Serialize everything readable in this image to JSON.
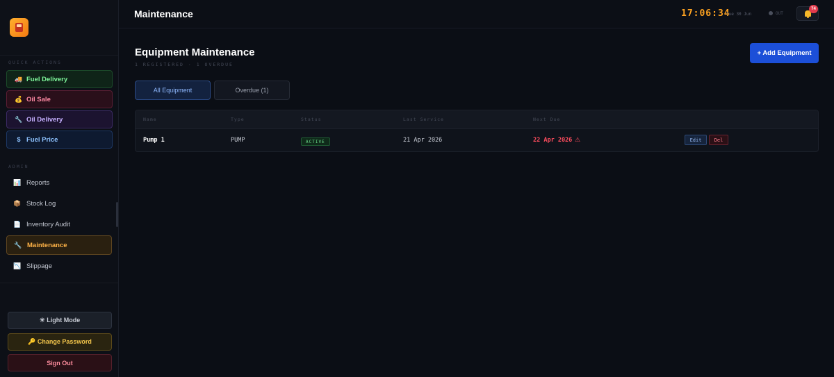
{
  "header": {
    "title": "Maintenance",
    "clock": "17:06:34",
    "date": "Tue 30 Jun",
    "shift_status": "OUT",
    "notification_count": "74"
  },
  "sidebar": {
    "quick_actions_label": "QUICK ACTIONS",
    "quick_actions": [
      {
        "label": "Fuel Delivery",
        "icon": "🚚"
      },
      {
        "label": "Oil Sale",
        "icon": "💰"
      },
      {
        "label": "Oil Delivery",
        "icon": "🔧"
      },
      {
        "label": "Fuel Price",
        "icon": "$"
      }
    ],
    "admin_label": "ADMIN",
    "admin_items": [
      {
        "label": "Reports",
        "icon": "📊"
      },
      {
        "label": "Stock Log",
        "icon": "📦"
      },
      {
        "label": "Inventory Audit",
        "icon": "📄"
      },
      {
        "label": "Maintenance",
        "icon": "🔧"
      },
      {
        "label": "Slippage",
        "icon": "📉"
      }
    ],
    "bottom": {
      "light_mode": "☀ Light Mode",
      "change_password": "🔑 Change Password",
      "sign_out": "Sign Out"
    }
  },
  "main": {
    "title": "Equipment Maintenance",
    "subtitle": "1 REGISTERED · 1 OVERDUE",
    "add_button": "+ Add Equipment",
    "tabs": [
      {
        "label": "All Equipment",
        "active": true
      },
      {
        "label": "Overdue (1)",
        "active": false
      }
    ],
    "table": {
      "columns": [
        "Name",
        "Type",
        "Status",
        "Last Service",
        "Next Due"
      ],
      "rows": [
        {
          "name": "Pump 1",
          "type": "PUMP",
          "status": "ACTIVE",
          "last_service": "21 Apr 2026",
          "next_due": "22 Apr 2026",
          "edit": "Edit",
          "delete": "Del"
        }
      ]
    }
  },
  "colors": {
    "accent": "#ffa321",
    "primary": "#1c4fd8",
    "danger": "#ff4d5e",
    "success": "#6fe08f"
  }
}
